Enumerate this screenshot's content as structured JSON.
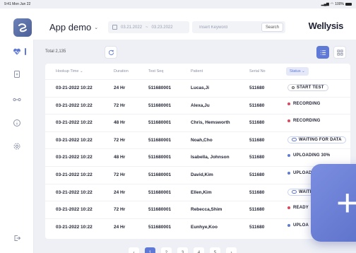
{
  "status_bar": {
    "time": "9:41",
    "date": "Mon Jun 22",
    "battery": "100%"
  },
  "header": {
    "app_title": "App demo",
    "date_start": "03.21.2022",
    "date_sep": "~",
    "date_end": "03.23.2022",
    "search_placeholder": "Insert Keyword",
    "search_label": "Search",
    "brand": "Wellysis"
  },
  "toolbar": {
    "total": "Total 2,135"
  },
  "table": {
    "headers": {
      "hookup_time": "Hookup Time",
      "duration": "Duration",
      "test_seq": "Test Seq",
      "patient": "Patient",
      "serial_no": "Serial No",
      "status": "Status"
    },
    "rows": [
      {
        "hookup_time": "03-21-2022 10:22",
        "duration": "24 Hr",
        "test_seq": "511680001",
        "patient": "Lucas,Ji",
        "serial_no": "511680",
        "status": "START TEST",
        "status_kind": "start"
      },
      {
        "hookup_time": "03-21-2022 10:22",
        "duration": "72 Hr",
        "test_seq": "511680001",
        "patient": "Alexa,Ju",
        "serial_no": "511680",
        "status": "RECORDING",
        "status_kind": "recording"
      },
      {
        "hookup_time": "03-21-2022 10:22",
        "duration": "48 Hr",
        "test_seq": "511680001",
        "patient": "Chris, Hemsworth",
        "serial_no": "511680",
        "status": "RECORDING",
        "status_kind": "recording"
      },
      {
        "hookup_time": "03-21-2022 10:22",
        "duration": "72 Hr",
        "test_seq": "511680001",
        "patient": "Noah,Cho",
        "serial_no": "511680",
        "status": "WAITING FOR DATA",
        "status_kind": "waiting"
      },
      {
        "hookup_time": "03-21-2022 10:22",
        "duration": "48 Hr",
        "test_seq": "511680001",
        "patient": "Isabella, Johnson",
        "serial_no": "511680",
        "status": "UPLOADING 30%",
        "status_kind": "uploading"
      },
      {
        "hookup_time": "03-21-2022 10:22",
        "duration": "72 Hr",
        "test_seq": "511680001",
        "patient": "David,Kim",
        "serial_no": "511680",
        "status": "UPLOAD PENDING",
        "status_kind": "uploading"
      },
      {
        "hookup_time": "03-21-2022 10:22",
        "duration": "24 Hr",
        "test_seq": "511680001",
        "patient": "Ellen,Kim",
        "serial_no": "511680",
        "status": "WAITING",
        "status_kind": "waiting"
      },
      {
        "hookup_time": "03-21-2022 10:22",
        "duration": "72 Hr",
        "test_seq": "511680001",
        "patient": "Rebecca,Shim",
        "serial_no": "511680",
        "status": "READY",
        "status_kind": "recording"
      },
      {
        "hookup_time": "03-21-2022 10:22",
        "duration": "24 Hr",
        "test_seq": "511680001",
        "patient": "Eunhye,Koo",
        "serial_no": "511680",
        "status": "UPLOA",
        "status_kind": "uploading"
      }
    ]
  },
  "pagination": {
    "prev": "‹",
    "next": "›",
    "pages": [
      "1",
      "2",
      "3",
      "4",
      "5"
    ],
    "current": "1"
  },
  "fab_label": "+",
  "colors": {
    "accent": "#5e79d6",
    "recording": "#e0455a",
    "uploading": "#5e79d6"
  },
  "icons": [
    "heart-monitor-icon",
    "document-icon",
    "connection-icon",
    "info-icon",
    "settings-icon",
    "logout-icon"
  ]
}
